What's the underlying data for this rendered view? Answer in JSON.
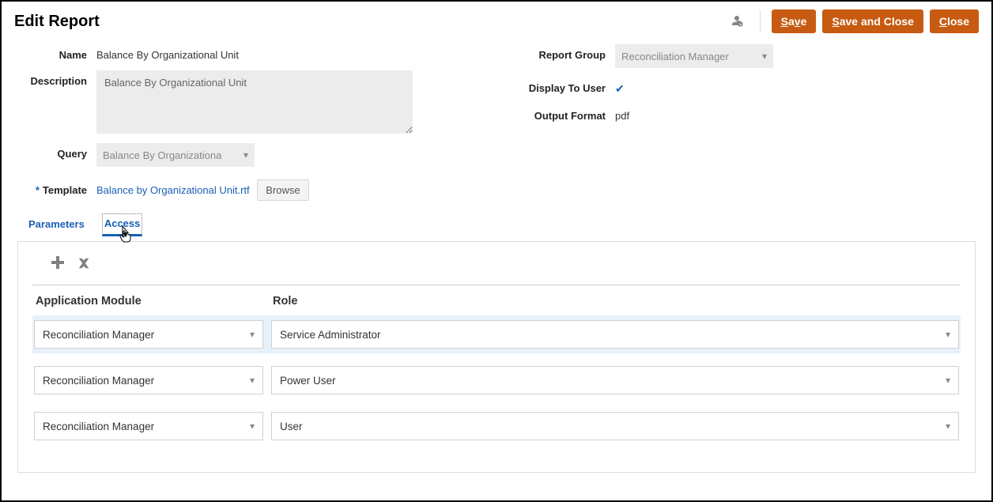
{
  "header": {
    "title": "Edit Report",
    "buttons": {
      "save": "Save",
      "save_close": "Save and Close",
      "close": "Close"
    }
  },
  "form": {
    "name_label": "Name",
    "name_value": "Balance By Organizational Unit",
    "description_label": "Description",
    "description_value": "Balance By Organizational Unit",
    "query_label": "Query",
    "query_value": "Balance By Organizational Unit",
    "template_label": "Template",
    "template_value": "Balance by Organizational Unit.rtf",
    "browse_label": "Browse",
    "report_group_label": "Report Group",
    "report_group_value": "Reconciliation Manager",
    "display_to_user_label": "Display To User",
    "display_to_user_checked": true,
    "output_format_label": "Output Format",
    "output_format_value": "pdf"
  },
  "tabs": {
    "parameters": "Parameters",
    "access": "Access",
    "active": "access"
  },
  "access": {
    "columns": {
      "module": "Application Module",
      "role": "Role"
    },
    "rows": [
      {
        "module": "Reconciliation Manager",
        "role": "Service Administrator",
        "selected": true
      },
      {
        "module": "Reconciliation Manager",
        "role": "Power User",
        "selected": false
      },
      {
        "module": "Reconciliation Manager",
        "role": "User",
        "selected": false
      }
    ]
  }
}
